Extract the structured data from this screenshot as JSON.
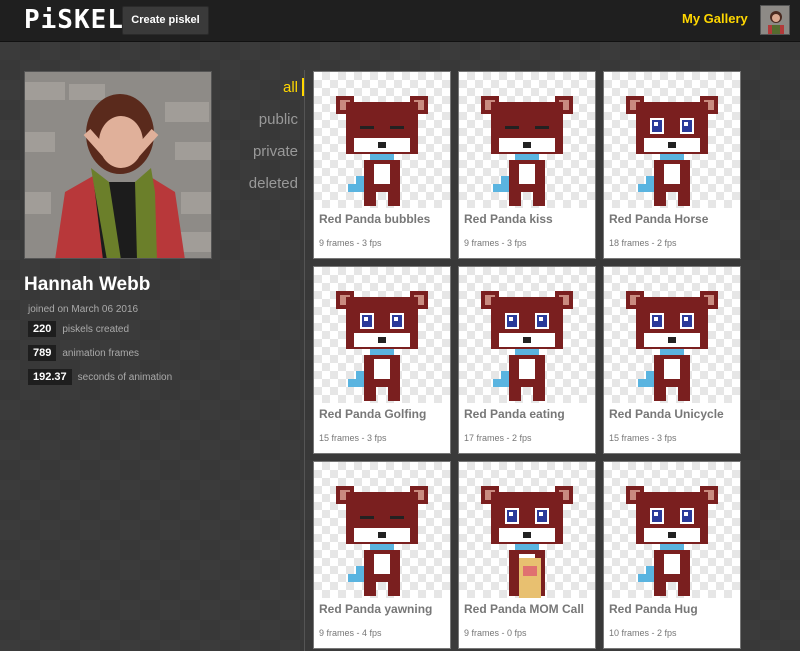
{
  "header": {
    "logo": "PiSKEL",
    "create_label": "Create piskel",
    "gallery_label": "My Gallery"
  },
  "profile": {
    "name": "Hannah Webb",
    "joined": "joined on March 06 2016",
    "stats": [
      {
        "value": "220",
        "label": "piskels created"
      },
      {
        "value": "789",
        "label": "animation frames"
      },
      {
        "value": "192.37",
        "label": "seconds of animation"
      }
    ]
  },
  "filters": [
    "all",
    "public",
    "private",
    "deleted"
  ],
  "active_filter": "all",
  "colors": {
    "accent": "#ffd700",
    "panda_body": "#7a1f1f",
    "panda_ear": "#c98b80",
    "panda_eye": "#2a3a9a",
    "collar": "#5ab4e0"
  },
  "cards": [
    {
      "title": "Red Panda bubbles",
      "meta": "9 frames - 3 fps"
    },
    {
      "title": "Red Panda kiss",
      "meta": "9 frames - 3 fps"
    },
    {
      "title": "Red Panda Horse",
      "meta": "18 frames - 2 fps"
    },
    {
      "title": "Red Panda Golfing",
      "meta": "15 frames - 3 fps"
    },
    {
      "title": "Red Panda eating",
      "meta": "17 frames - 2 fps"
    },
    {
      "title": "Red Panda Unicycle",
      "meta": "15 frames - 3 fps"
    },
    {
      "title": "Red Panda yawning",
      "meta": "9 frames - 4 fps"
    },
    {
      "title": "Red Panda MOM Call",
      "meta": "9 frames - 0 fps"
    },
    {
      "title": "Red Panda Hug",
      "meta": "10 frames - 2 fps"
    }
  ]
}
